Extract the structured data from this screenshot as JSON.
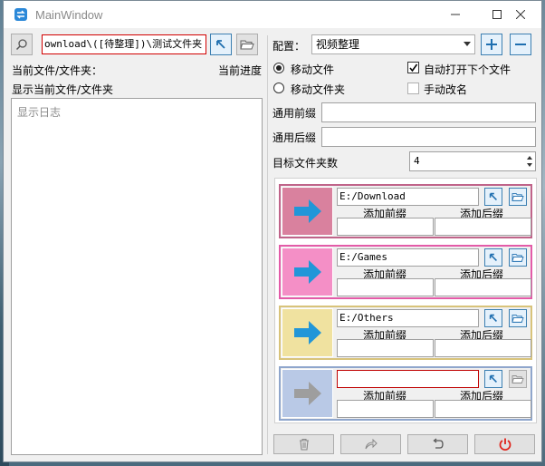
{
  "window": {
    "title": "MainWindow"
  },
  "left": {
    "path_value": "ownload\\([待整理])\\测试文件夹",
    "current_label": "当前文件/文件夹：",
    "progress_label": "当前进度",
    "display_label": "显示当前文件/文件夹",
    "log_placeholder": "显示日志"
  },
  "right": {
    "config_label": "配置：",
    "config_value": "视频整理",
    "move_file": "移动文件",
    "move_folder": "移动文件夹",
    "auto_open_next": "自动打开下个文件",
    "manual_rename": "手动改名",
    "common_prefix": "通用前缀",
    "common_suffix": "通用后缀",
    "target_count_label": "目标文件夹数",
    "target_count": "4"
  },
  "targets": [
    {
      "path": "E:/Download",
      "prefix_label": "添加前缀",
      "suffix_label": "添加后缀",
      "color": "#c0648a",
      "bg": "#d9819e"
    },
    {
      "path": "E:/Games",
      "prefix_label": "添加前缀",
      "suffix_label": "添加后缀",
      "color": "#e35ba8",
      "bg": "#f48fc6"
    },
    {
      "path": "E:/Others",
      "prefix_label": "添加前缀",
      "suffix_label": "添加后缀",
      "color": "#d8c37a",
      "bg": "#f0e2a0"
    },
    {
      "path": "",
      "prefix_label": "添加前缀",
      "suffix_label": "添加后缀",
      "color": "#8fa6cc",
      "bg": "#b9c9e6"
    }
  ],
  "colors": {
    "accent_blue": "#3c7fb1",
    "arrow_blue": "#2196d8",
    "arrow_grey": "#9e9e9e",
    "power_red": "#e0241b"
  }
}
